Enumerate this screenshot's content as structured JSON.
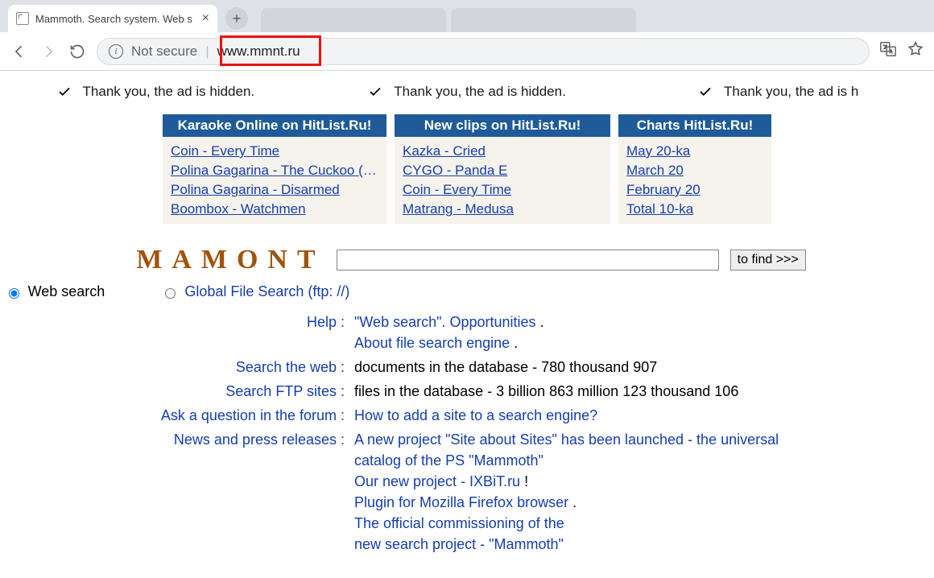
{
  "browser": {
    "tab_title": "Mammoth. Search system. Web s",
    "not_secure": "Not secure",
    "url": "www.mmnt.ru"
  },
  "ads": {
    "msg1": "Thank you, the ad is hidden.",
    "msg2": "Thank you, the ad is hidden.",
    "msg3": "Thank you, the ad is h"
  },
  "cols": {
    "a": {
      "hdr": "Karaoke Online on HitList.Ru!",
      "items": [
        "Coin - Every Time",
        "Polina Gagarina - The Cuckoo (Sau ...",
        "Polina Gagarina - Disarmed",
        "Boombox - Watchmen"
      ]
    },
    "b": {
      "hdr": "New clips on HitList.Ru!",
      "items": [
        "Kazka - Cried",
        "CYGO - Panda E",
        "Coin - Every Time",
        "Matrang - Medusa"
      ]
    },
    "c": {
      "hdr": "Charts HitList.Ru!",
      "items": [
        "May 20-ka",
        "March 20",
        "February 20",
        "Total 10-ka"
      ]
    }
  },
  "logo": "MAMONT",
  "search": {
    "button": "to find >>>",
    "radio_web": "Web search",
    "radio_ftp": "Global File Search (ftp: //)"
  },
  "rows": {
    "help_l": "Help :",
    "help_r1": "\"Web search\". Opportunities",
    "help_r2": "About file search engine",
    "web_l": "Search the web :",
    "web_r": "documents in the database - 780 thousand 907",
    "ftp_l": "Search FTP sites :",
    "ftp_r": "files in the database - 3 billion 863 million 123 thousand 106",
    "forum_l": "Ask a question in the forum :",
    "forum_r": "How to add a site to a search engine?",
    "news_l": "News and press releases :",
    "news_r1a": "A new project \"Site about Sites\" has been launched",
    "news_r1b": " - the universal catalog of the PS \"Mammoth\"",
    "news_r2a": "Our new project - IXBiT.ru",
    "news_r2b": " !",
    "news_r3a": "Plugin for Mozilla Firefox browser",
    "news_r3b": " .",
    "news_r4": "The official commissioning of the",
    "news_r5a": "new search project - \"Mammoth\"",
    "dot": " ."
  }
}
